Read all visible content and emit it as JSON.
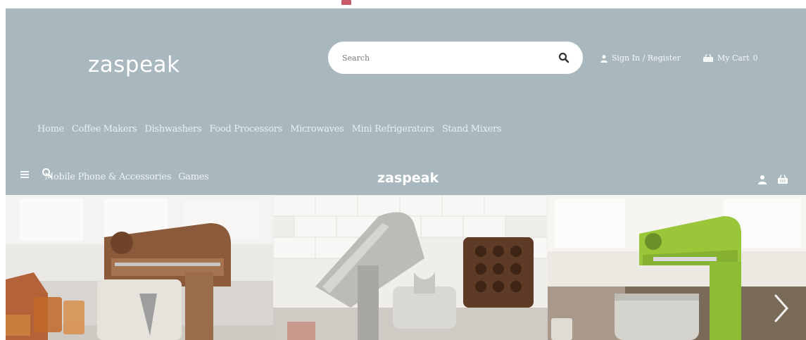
{
  "brand": {
    "logo": "zaspeak",
    "logo_small": "zaspeak"
  },
  "search": {
    "placeholder": "Search"
  },
  "account": {
    "label": "Sign In / Register"
  },
  "cart": {
    "label": "My Cart",
    "count": "0"
  },
  "nav": {
    "items": [
      "Home",
      "Coffee Makers",
      "Dishwashers",
      "Food Processors",
      "Microwaves",
      "Mini Refrigerators",
      "Stand Mixers"
    ]
  },
  "subnav": {
    "items": [
      "Mobile Phone & Accessories",
      "Games"
    ]
  },
  "icons": {
    "search": "search-icon",
    "user": "user-icon",
    "cart": "cart-icon",
    "menu": "menu-icon",
    "next": "chevron-right-icon"
  },
  "colors": {
    "header_bg": "#a9b8be",
    "white": "#ffffff",
    "mixer_green": "#9ac73a"
  },
  "banner": {
    "slides": [
      "copper stand mixer",
      "silver stand mixer",
      "green stand mixer"
    ]
  }
}
